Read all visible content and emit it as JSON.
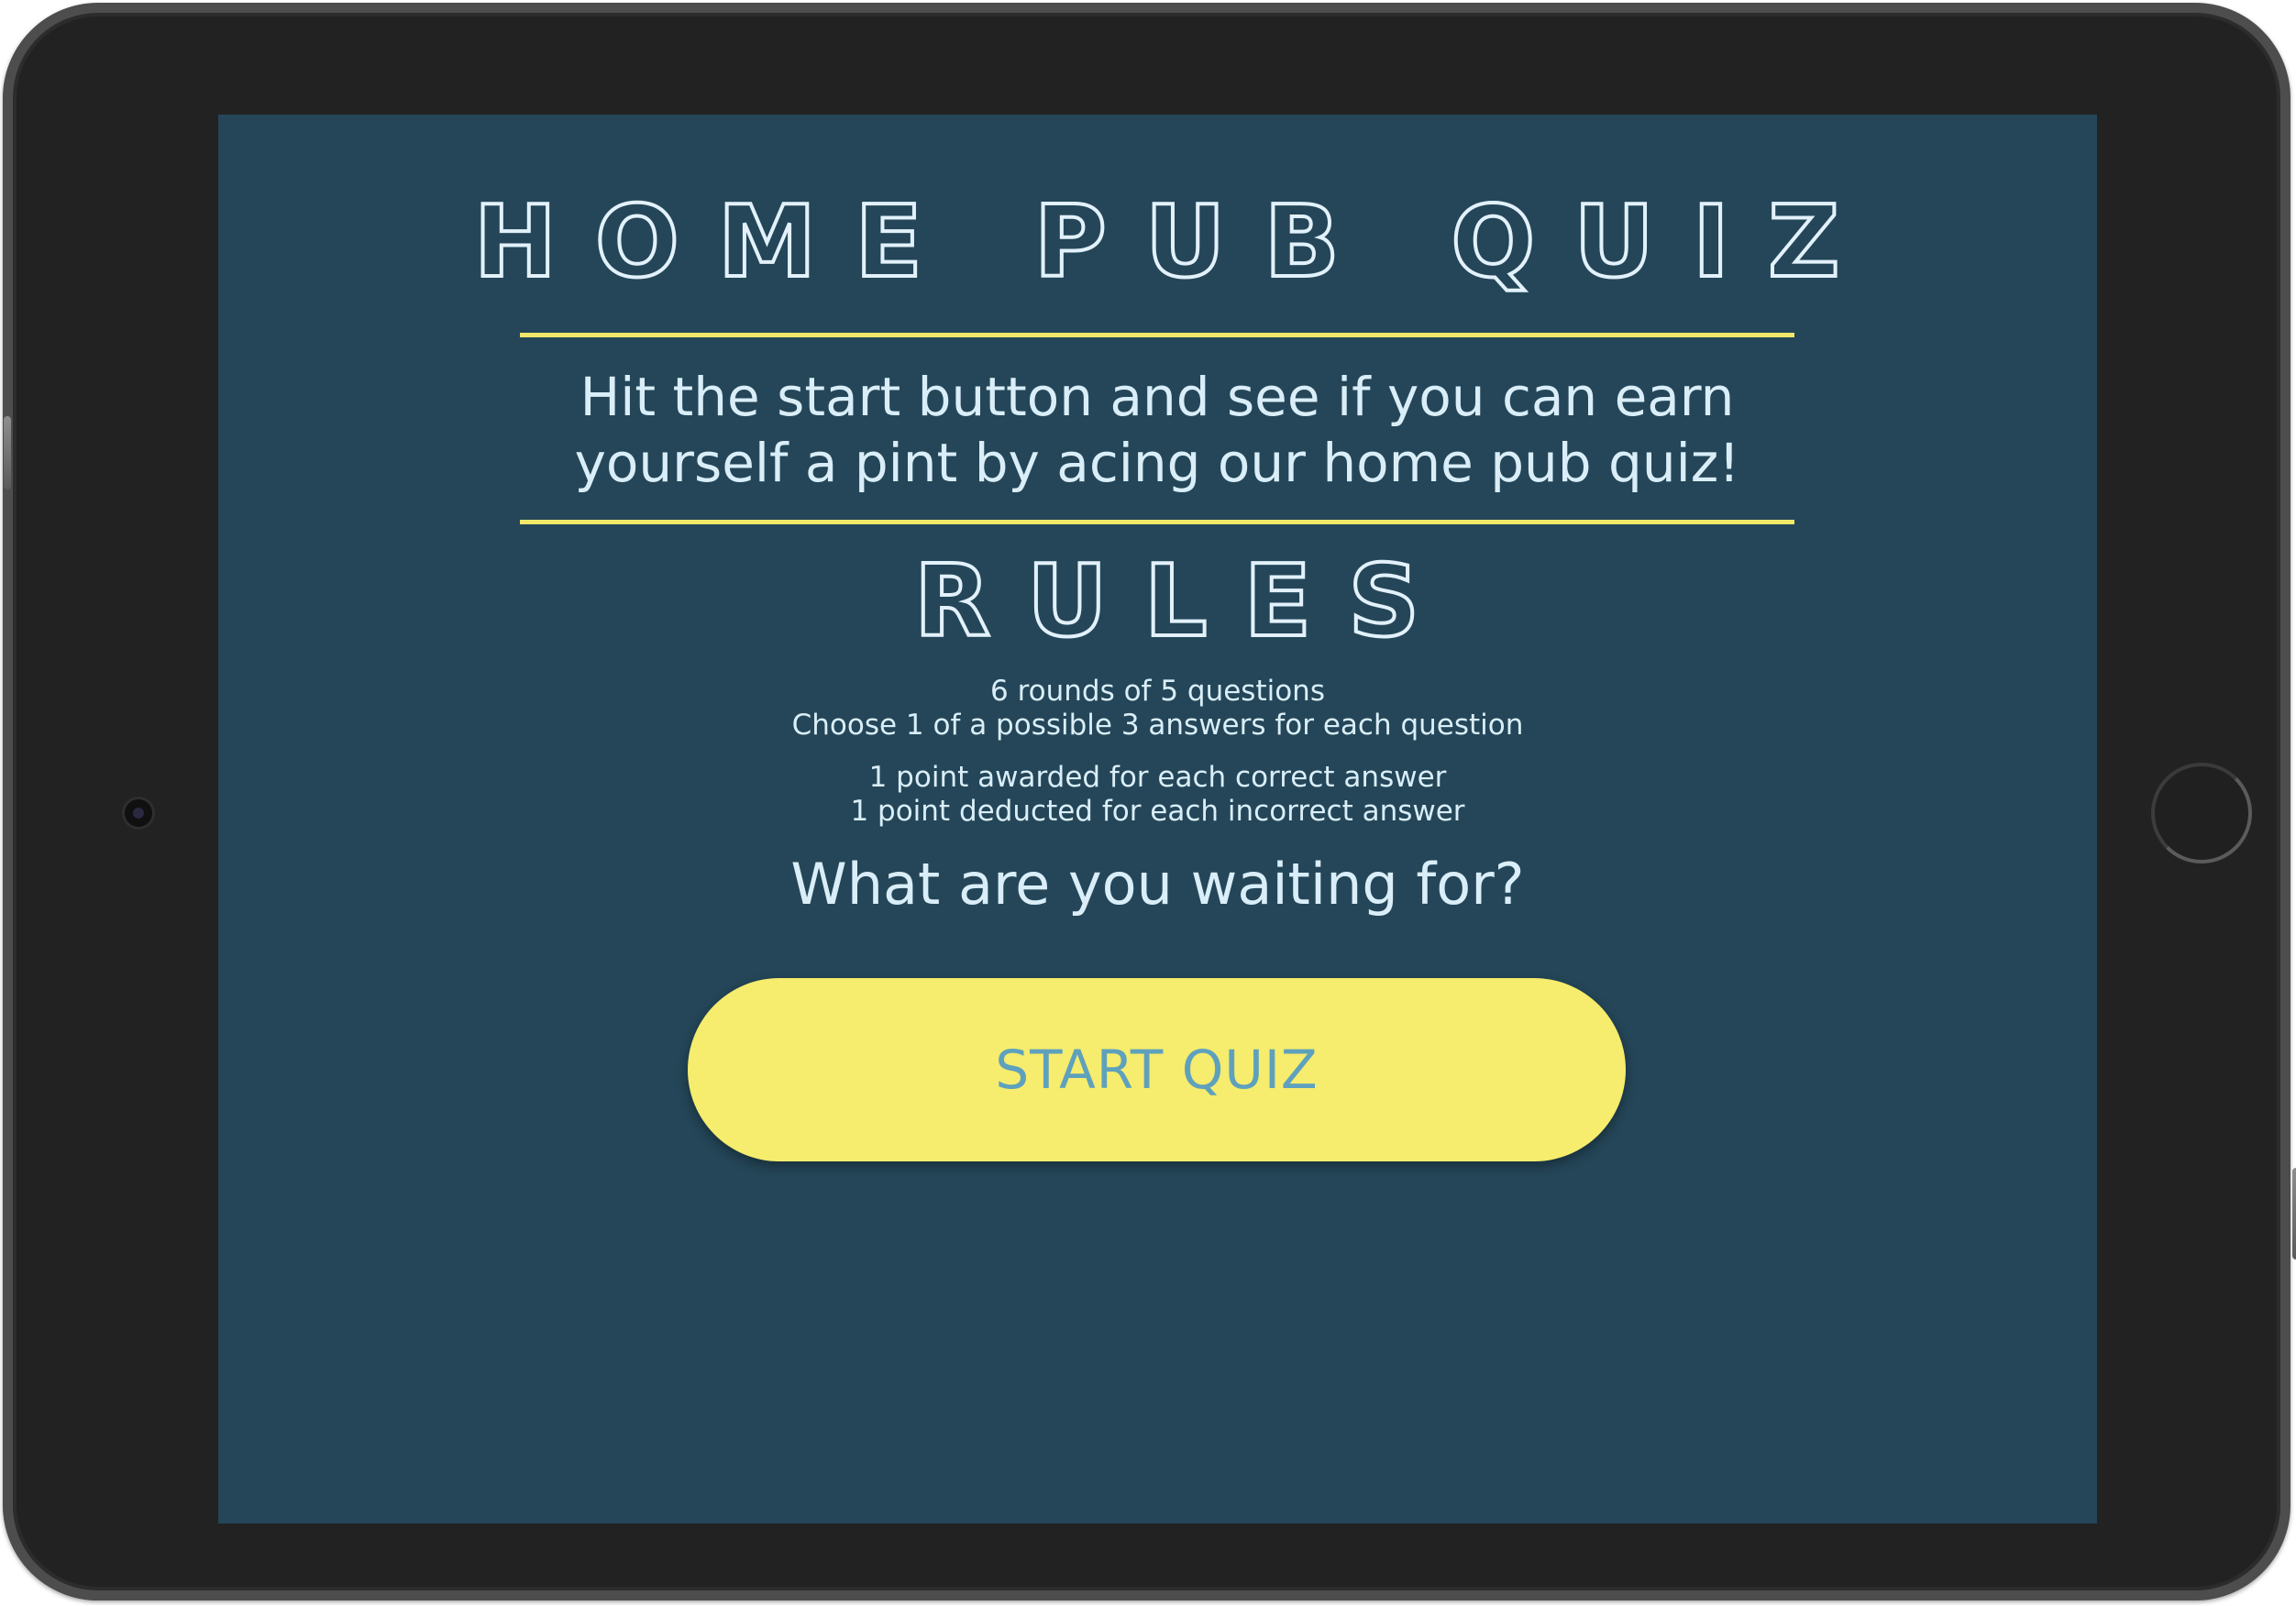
{
  "quiz": {
    "title": "HOME PUB QUIZ",
    "intro_line1": "Hit the start button and see if you can earn",
    "intro_line2": "yourself a pint by acing our home pub quiz!",
    "rules_heading": "RULES",
    "rules": [
      "6 rounds of 5 questions",
      "Choose 1 of a possible 3 answers for each question",
      "1 point awarded for each correct answer",
      "1 point deducted for each incorrect answer"
    ],
    "prompt": "What are you waiting for?",
    "start_label": "START QUIZ"
  },
  "colors": {
    "screen_background": "#244658",
    "accent_yellow": "#f6ec6d",
    "text_light": "#d9eef8",
    "button_text": "#5ea1bd"
  }
}
